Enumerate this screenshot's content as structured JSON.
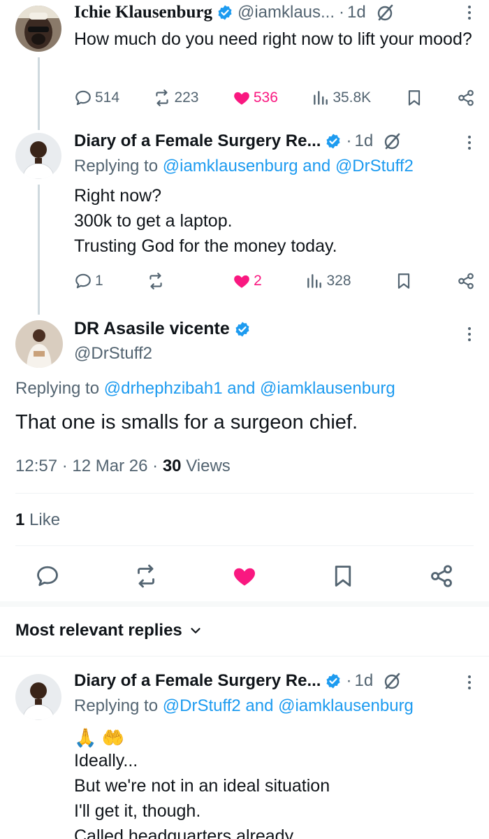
{
  "posts": [
    {
      "author": "Ichie Klausenburg",
      "handle": "@iamklaus...",
      "time": "1d",
      "text": "How much do you need right now to lift your mood?",
      "stats": {
        "replies": "514",
        "reposts": "223",
        "likes": "536",
        "views": "35.8K"
      }
    },
    {
      "author": "Diary of a Female Surgery Re...",
      "time": "1d",
      "replying_label": "Replying to",
      "replying_to": [
        "@iamklausenburg",
        "@DrStuff2"
      ],
      "and": "and",
      "lines": [
        "Right now?",
        "300k to get a laptop.",
        "Trusting God for the money today."
      ],
      "stats": {
        "replies": "1",
        "reposts": "",
        "likes": "2",
        "views": "328"
      }
    }
  ],
  "focus": {
    "author": "DR Asasile vicente",
    "handle": "@DrStuff2",
    "replying_label": "Replying to",
    "replying_to": [
      "@drhephzibah1",
      "@iamklausenburg"
    ],
    "and": "and",
    "text": "That one is smalls for a surgeon chief.",
    "time": "12:57",
    "date": "12 Mar 26",
    "views_count": "30",
    "views_label": "Views",
    "likes_count": "1",
    "likes_label": "Like"
  },
  "sort": {
    "label": "Most relevant replies"
  },
  "reply": {
    "author": "Diary of a Female Surgery Re...",
    "time": "1d",
    "replying_label": "Replying to",
    "replying_to": [
      "@DrStuff2",
      "@iamklausenburg"
    ],
    "and": "and",
    "emoji": "🙏 🤲",
    "lines": [
      "Ideally...",
      "But we're not in an ideal situation",
      "I'll get it, though.",
      "Called headquarters already"
    ]
  },
  "separator_dot": "·",
  "colors": {
    "accent": "#1d9bf0",
    "like": "#f91880",
    "muted": "#536471",
    "text": "#0f1419"
  }
}
